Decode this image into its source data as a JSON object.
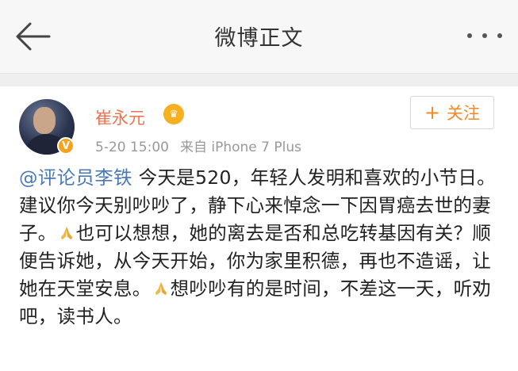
{
  "header": {
    "title": "微博正文"
  },
  "post": {
    "username": "崔永元",
    "date": "5-20 15:00",
    "source": "来自 iPhone 7 Plus",
    "follow_label": "关注",
    "mention": "@评论员李铁",
    "text_1": " 今天是520，年轻人发明和喜欢的小节日。建议你今天别吵吵了，静下心来悼念一下因胃癌去世的妻子。",
    "text_2": "也可以想想，她的离去是否和总吃转基因有关？顺便告诉她，从今天开始，你为家里积德，再也不造谣，让她在天堂安息。",
    "text_3": "想吵吵有的是时间，不差这一天，听劝吧，读书人。"
  },
  "colors": {
    "username": "#eb7350",
    "mention": "#4a79b8",
    "follow": "#f08a24",
    "meta": "#999999"
  },
  "icons": [
    "back-arrow-icon",
    "more-icon",
    "verified-badge-icon",
    "vip-icon",
    "pray-emoji-icon"
  ]
}
